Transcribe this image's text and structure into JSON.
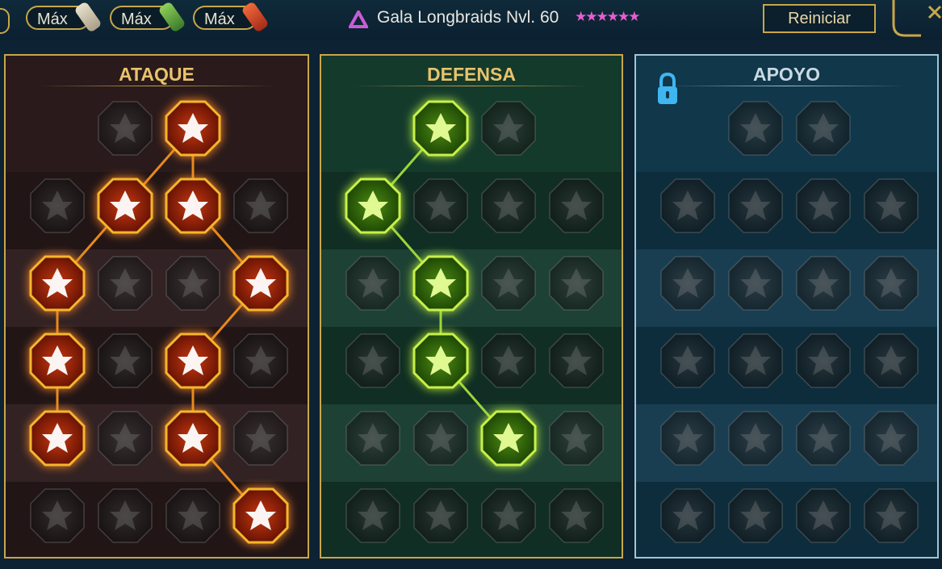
{
  "header": {
    "currency_pills": [
      {
        "label": "Máx",
        "icon": "scroll-icon"
      },
      {
        "label": "Máx",
        "icon": "green-scroll-icon"
      },
      {
        "label": "Máx",
        "icon": "red-scroll-icon"
      }
    ],
    "hero_title": "Gala Longbraids Nvl. 60",
    "stars": "★★★★★★",
    "reset_label": "Reiniciar"
  },
  "colors": {
    "attack": "#ff6a1a",
    "defense": "#a6e22e",
    "support": "#4fb8e8",
    "gold": "#c9a64a"
  },
  "trees": [
    {
      "key": "atk",
      "title": "ATAQUE",
      "nodes": [
        {
          "r": 0,
          "c": 1,
          "active": false,
          "icon": "crossed-swords-icon"
        },
        {
          "r": 0,
          "c": 2,
          "active": true,
          "icon": "blade-slash-icon"
        },
        {
          "r": 1,
          "c": 0,
          "active": false,
          "icon": "demon-figure-icon"
        },
        {
          "r": 1,
          "c": 1,
          "active": true,
          "icon": "shattered-blade-icon"
        },
        {
          "r": 1,
          "c": 2,
          "active": true,
          "icon": "shield-break-icon"
        },
        {
          "r": 1,
          "c": 3,
          "active": false,
          "icon": "heart-thorn-icon"
        },
        {
          "r": 2,
          "c": 0,
          "active": true,
          "icon": "arrow-pierced-warrior-icon"
        },
        {
          "r": 2,
          "c": 1,
          "active": false,
          "icon": "fanged-maw-icon"
        },
        {
          "r": 2,
          "c": 2,
          "active": false,
          "icon": "hooded-skull-icon"
        },
        {
          "r": 2,
          "c": 3,
          "active": true,
          "icon": "dagger-strike-icon"
        },
        {
          "r": 3,
          "c": 0,
          "active": true,
          "icon": "bleeding-heart-icon"
        },
        {
          "r": 3,
          "c": 1,
          "active": false,
          "icon": "fist-icon"
        },
        {
          "r": 3,
          "c": 2,
          "active": true,
          "icon": "axe-icon"
        },
        {
          "r": 3,
          "c": 3,
          "active": false,
          "icon": "chain-lightning-icon"
        },
        {
          "r": 4,
          "c": 0,
          "active": true,
          "icon": "arrow-impact-icon"
        },
        {
          "r": 4,
          "c": 1,
          "active": false,
          "icon": "skull-icon"
        },
        {
          "r": 4,
          "c": 2,
          "active": true,
          "icon": "sword-aura-icon"
        },
        {
          "r": 4,
          "c": 3,
          "active": false,
          "icon": "muscle-man-icon"
        },
        {
          "r": 5,
          "c": 0,
          "active": false,
          "icon": "sword-sparkle-icon"
        },
        {
          "r": 5,
          "c": 1,
          "active": false,
          "icon": "knight-helm-icon"
        },
        {
          "r": 5,
          "c": 2,
          "active": false,
          "icon": "demon-wings-icon"
        },
        {
          "r": 5,
          "c": 3,
          "active": true,
          "icon": "spartan-skull-icon"
        }
      ],
      "links": [
        [
          [
            0,
            2
          ],
          [
            1,
            1
          ]
        ],
        [
          [
            0,
            2
          ],
          [
            1,
            2
          ]
        ],
        [
          [
            1,
            1
          ],
          [
            2,
            0
          ]
        ],
        [
          [
            1,
            2
          ],
          [
            2,
            3
          ]
        ],
        [
          [
            2,
            0
          ],
          [
            3,
            0
          ]
        ],
        [
          [
            2,
            3
          ],
          [
            3,
            2
          ]
        ],
        [
          [
            3,
            0
          ],
          [
            4,
            0
          ]
        ],
        [
          [
            3,
            2
          ],
          [
            4,
            2
          ]
        ],
        [
          [
            4,
            2
          ],
          [
            5,
            3
          ]
        ]
      ]
    },
    {
      "key": "def",
      "title": "DEFENSA",
      "nodes": [
        {
          "r": 0,
          "c": 1,
          "active": true,
          "icon": "scale-armor-icon"
        },
        {
          "r": 0,
          "c": 2,
          "active": false,
          "icon": "raised-fist-icon"
        },
        {
          "r": 1,
          "c": 0,
          "active": true,
          "icon": "chevron-shield-icon"
        },
        {
          "r": 1,
          "c": 1,
          "active": false,
          "icon": "leaf-shield-icon"
        },
        {
          "r": 1,
          "c": 2,
          "active": false,
          "icon": "warrior-stance-icon"
        },
        {
          "r": 1,
          "c": 3,
          "active": false,
          "icon": "broken-sword-icon"
        },
        {
          "r": 2,
          "c": 0,
          "active": false,
          "icon": "cloak-icon"
        },
        {
          "r": 2,
          "c": 1,
          "active": true,
          "icon": "knight-shield-icon"
        },
        {
          "r": 2,
          "c": 2,
          "active": false,
          "icon": "shield-heart-icon"
        },
        {
          "r": 2,
          "c": 3,
          "active": false,
          "icon": "aura-figure-icon"
        },
        {
          "r": 3,
          "c": 0,
          "active": false,
          "icon": "phalanx-icon"
        },
        {
          "r": 3,
          "c": 1,
          "active": true,
          "icon": "hourglass-skull-icon"
        },
        {
          "r": 3,
          "c": 2,
          "active": false,
          "icon": "open-hand-icon"
        },
        {
          "r": 3,
          "c": 3,
          "active": false,
          "icon": "bull-head-icon"
        },
        {
          "r": 4,
          "c": 0,
          "active": false,
          "icon": "dash-runner-icon"
        },
        {
          "r": 4,
          "c": 1,
          "active": false,
          "icon": "triple-drop-icon"
        },
        {
          "r": 4,
          "c": 2,
          "active": true,
          "icon": "sun-skull-icon"
        },
        {
          "r": 4,
          "c": 3,
          "active": false,
          "icon": "swirl-icon"
        },
        {
          "r": 5,
          "c": 0,
          "active": false,
          "icon": "armored-torso-icon"
        },
        {
          "r": 5,
          "c": 1,
          "active": false,
          "icon": "runed-shield-icon"
        },
        {
          "r": 5,
          "c": 2,
          "active": false,
          "icon": "ogre-face-icon"
        },
        {
          "r": 5,
          "c": 3,
          "active": false,
          "icon": "flexing-figure-icon"
        }
      ],
      "links": [
        [
          [
            0,
            1
          ],
          [
            1,
            0
          ]
        ],
        [
          [
            1,
            0
          ],
          [
            2,
            1
          ]
        ],
        [
          [
            2,
            1
          ],
          [
            3,
            1
          ]
        ],
        [
          [
            3,
            1
          ],
          [
            4,
            2
          ]
        ]
      ]
    },
    {
      "key": "sup",
      "title": "APOYO",
      "locked": true,
      "nodes": [
        {
          "r": 0,
          "c": 1,
          "active": false,
          "icon": "heart-plus-icon"
        },
        {
          "r": 0,
          "c": 2,
          "active": false,
          "icon": "spiral-orb-icon"
        },
        {
          "r": 1,
          "c": 0,
          "active": false,
          "icon": "praying-hands-icon"
        },
        {
          "r": 1,
          "c": 1,
          "active": false,
          "icon": "radiant-shield-icon"
        },
        {
          "r": 1,
          "c": 2,
          "active": false,
          "icon": "smoke-skull-icon"
        },
        {
          "r": 1,
          "c": 3,
          "active": false,
          "icon": "speed-boot-icon"
        },
        {
          "r": 2,
          "c": 0,
          "active": false,
          "icon": "blessed-figure-icon"
        },
        {
          "r": 2,
          "c": 1,
          "active": false,
          "icon": "lightning-shield-icon"
        },
        {
          "r": 2,
          "c": 2,
          "active": false,
          "icon": "wind-icon"
        },
        {
          "r": 2,
          "c": 3,
          "active": false,
          "icon": "silhouette-icon"
        },
        {
          "r": 3,
          "c": 0,
          "active": false,
          "icon": "chained-heart-icon"
        },
        {
          "r": 3,
          "c": 1,
          "active": false,
          "icon": "comet-icon"
        },
        {
          "r": 3,
          "c": 2,
          "active": false,
          "icon": "spell-book-icon"
        },
        {
          "r": 3,
          "c": 3,
          "active": false,
          "icon": "fierce-face-icon"
        },
        {
          "r": 4,
          "c": 0,
          "active": false,
          "icon": "compass-star-icon"
        },
        {
          "r": 4,
          "c": 1,
          "active": false,
          "icon": "winged-boot-icon"
        },
        {
          "r": 4,
          "c": 2,
          "active": false,
          "icon": "all-seeing-eye-icon"
        },
        {
          "r": 4,
          "c": 3,
          "active": false,
          "icon": "crossed-arrows-icon"
        },
        {
          "r": 5,
          "c": 0,
          "active": false,
          "icon": "potion-flask-icon"
        },
        {
          "r": 5,
          "c": 1,
          "active": false,
          "icon": "horned-skull-icon"
        },
        {
          "r": 5,
          "c": 2,
          "active": false,
          "icon": "tribal-mask-icon"
        },
        {
          "r": 5,
          "c": 3,
          "active": false,
          "icon": "eagle-head-icon"
        }
      ],
      "links": []
    }
  ]
}
